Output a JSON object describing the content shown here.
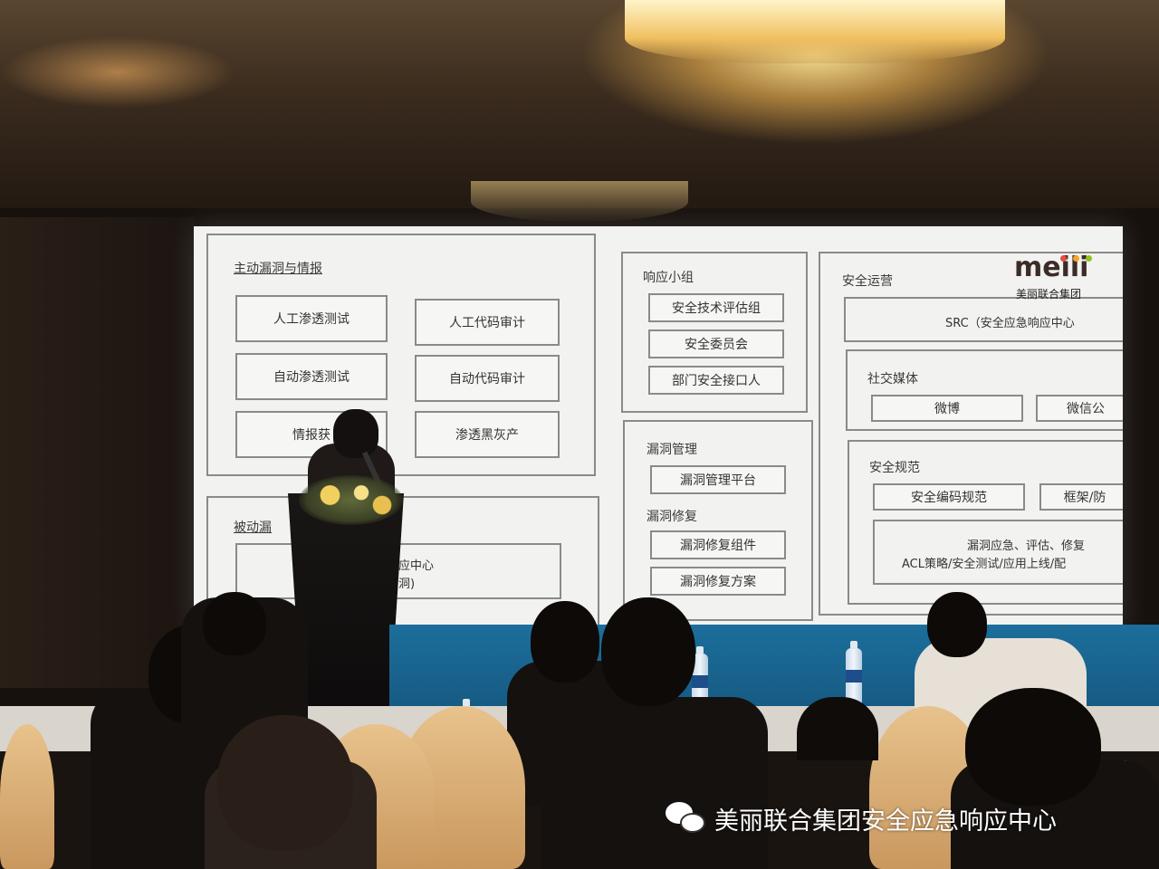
{
  "slide": {
    "proactive": {
      "title": "主动漏洞与情报",
      "items": [
        "人工渗透测试",
        "人工代码审计",
        "自动渗透测试",
        "自动代码审计",
        "情报获",
        "渗透黑灰产"
      ]
    },
    "passive": {
      "title": "被动漏",
      "line1": "急响应中心",
      "line2": "与漏洞)"
    },
    "response": {
      "title": "响应小组",
      "items": [
        "安全技术评估组",
        "安全委员会",
        "部门安全接口人"
      ]
    },
    "vuln": {
      "title": "漏洞管理",
      "platform": "漏洞管理平台",
      "repair_title": "漏洞修复",
      "repair_items": [
        "漏洞修复组件",
        "漏洞修复方案"
      ]
    },
    "ops": {
      "title": "安全运营",
      "src": "SRC（安全应急响应中心",
      "social_title": "社交媒体",
      "social_items": [
        "微博",
        "微信公"
      ],
      "norms_title": "安全规范",
      "norms_items": [
        "安全编码规范",
        "框架/防"
      ],
      "process_line1": "漏洞应急、评估、修复",
      "process_line2": "ACL策略/安全测试/应用上线/配"
    },
    "logo": {
      "word": "meili",
      "subtitle": "美丽联合集团",
      "dot_colors": [
        "#e84c3d",
        "#f5a623",
        "#8fc31f"
      ]
    }
  },
  "watermark": {
    "icon": "wechat-icon",
    "text": "美丽联合集团安全应急响应中心"
  }
}
